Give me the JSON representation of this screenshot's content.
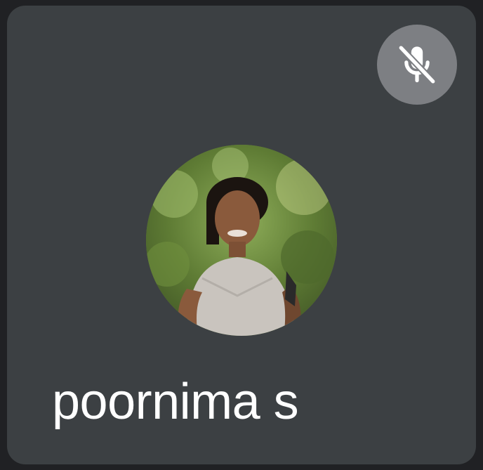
{
  "participant": {
    "name": "poornima s",
    "mic_icon": "mic-off-icon",
    "avatar_icon": "participant-photo"
  },
  "colors": {
    "page_background": "#202124",
    "tile_background": "#3c4043",
    "mute_button_background": "#7d7f83",
    "name_text": "#ffffff"
  }
}
